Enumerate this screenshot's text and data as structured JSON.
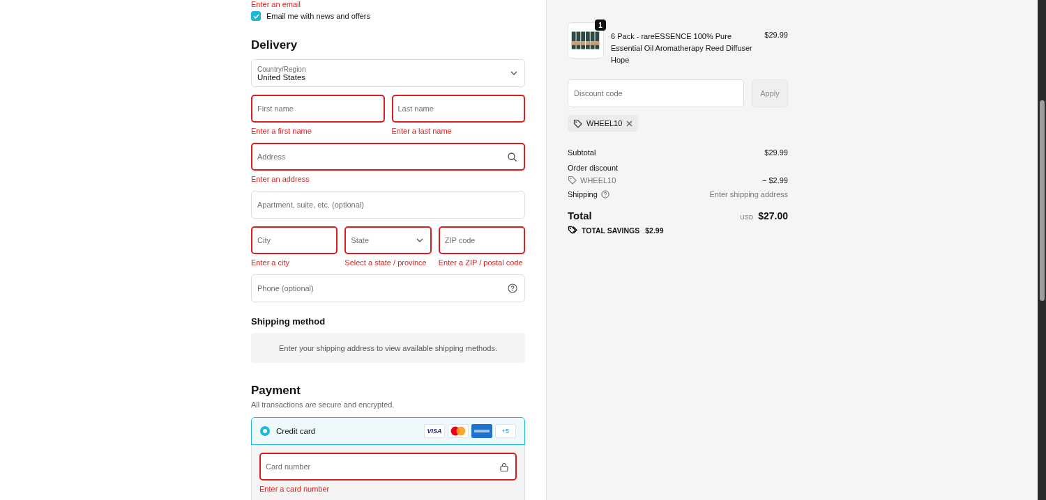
{
  "contact": {
    "error": "Enter an email",
    "newsletter": {
      "label": "Email me with news and offers",
      "checked": true
    }
  },
  "delivery": {
    "heading": "Delivery",
    "rows": [
      [
        {
          "kind": "select",
          "label": "Country/Region",
          "value": "United States",
          "invalid": false
        }
      ],
      [
        {
          "kind": "text",
          "placeholder": "First name",
          "invalid": true,
          "error": "Enter a first name"
        },
        {
          "kind": "text",
          "placeholder": "Last name",
          "invalid": true,
          "error": "Enter a last name"
        }
      ],
      [
        {
          "kind": "search",
          "placeholder": "Address",
          "invalid": true,
          "error": "Enter an address"
        }
      ],
      [
        {
          "kind": "text",
          "placeholder": "Apartment, suite, etc. (optional)",
          "invalid": false
        }
      ],
      [
        {
          "kind": "text",
          "placeholder": "City",
          "invalid": true,
          "error": "Enter a city"
        },
        {
          "kind": "select",
          "placeholder": "State",
          "invalid": true,
          "error": "Select a state / province"
        },
        {
          "kind": "text",
          "placeholder": "ZIP code",
          "invalid": true,
          "error": "Enter a ZIP / postal code"
        }
      ],
      [
        {
          "kind": "help",
          "placeholder": "Phone (optional)",
          "invalid": false
        }
      ]
    ]
  },
  "shipping_method": {
    "heading": "Shipping method",
    "message": "Enter your shipping address to view available shipping methods."
  },
  "payment": {
    "heading": "Payment",
    "note": "All transactions are secure and encrypted.",
    "methods": [
      {
        "label": "Credit card",
        "selected": true,
        "card_brands": [
          {
            "kind": "visa",
            "label": "VISA"
          },
          {
            "kind": "mastercard"
          },
          {
            "kind": "amex"
          },
          {
            "kind": "more",
            "label": "+5"
          }
        ],
        "fields": [
          {
            "kind": "lock",
            "placeholder": "Card number",
            "invalid": true,
            "error": "Enter a card number"
          }
        ]
      }
    ]
  },
  "summary": {
    "items": [
      {
        "quantity": "1",
        "title": "6 Pack - rareESSENCE 100% Pure Essential Oil Aromatherapy Reed Diffuser Hope",
        "price": "$29.99"
      }
    ],
    "discount": {
      "placeholder": "Discount code",
      "button": "Apply",
      "disabled": true
    },
    "applied_codes": [
      {
        "code": "WHEEL10"
      }
    ],
    "lines": [
      {
        "kind": "plain",
        "label": "Subtotal",
        "value": "$29.99"
      },
      {
        "kind": "heading",
        "label": "Order discount"
      },
      {
        "kind": "code",
        "label": "WHEEL10",
        "value": "− $2.99"
      },
      {
        "kind": "help",
        "label": "Shipping",
        "value": "Enter shipping address"
      }
    ],
    "total": {
      "label": "Total",
      "currency": "USD",
      "amount": "$27.00"
    },
    "savings": {
      "label": "TOTAL SAVINGS",
      "amount": "$2.99"
    }
  }
}
